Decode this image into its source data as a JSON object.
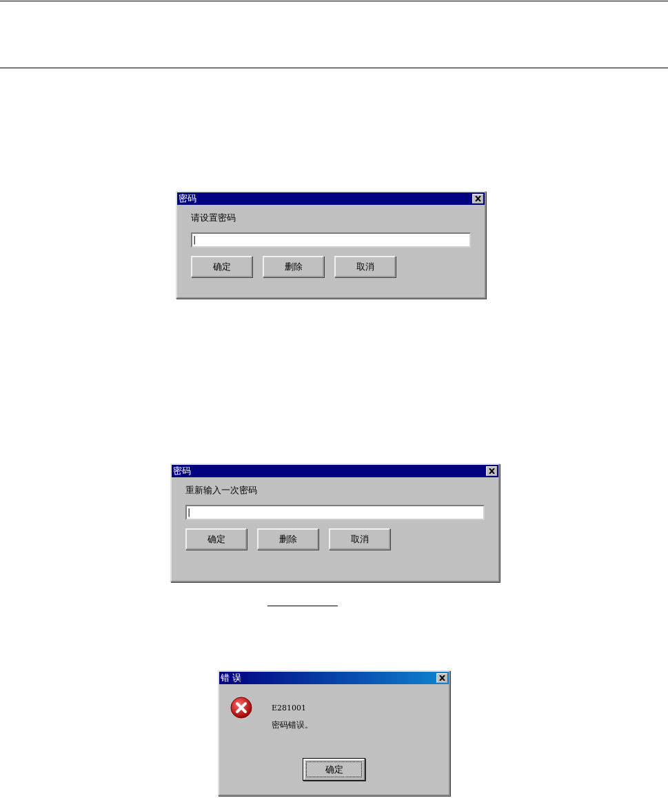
{
  "dialogs": [
    {
      "kind": "input",
      "title": "密码",
      "prompt": "请设置密码",
      "field": {
        "value": "|"
      },
      "buttons": [
        {
          "label": "确定",
          "focused": false
        },
        {
          "label": "删除",
          "focused": false
        },
        {
          "label": "取消",
          "focused": false
        }
      ]
    },
    {
      "kind": "input",
      "title": "密码",
      "prompt": "重新输入一次密码",
      "field": {
        "value": "|"
      },
      "buttons": [
        {
          "label": "确定",
          "focused": false
        },
        {
          "label": "删除",
          "focused": false
        },
        {
          "label": "取消",
          "focused": false
        }
      ]
    },
    {
      "kind": "message",
      "title": "错 误",
      "code": "E281001",
      "message": "密码错误。",
      "buttons": [
        {
          "label": "确定",
          "focused": true
        }
      ]
    }
  ]
}
